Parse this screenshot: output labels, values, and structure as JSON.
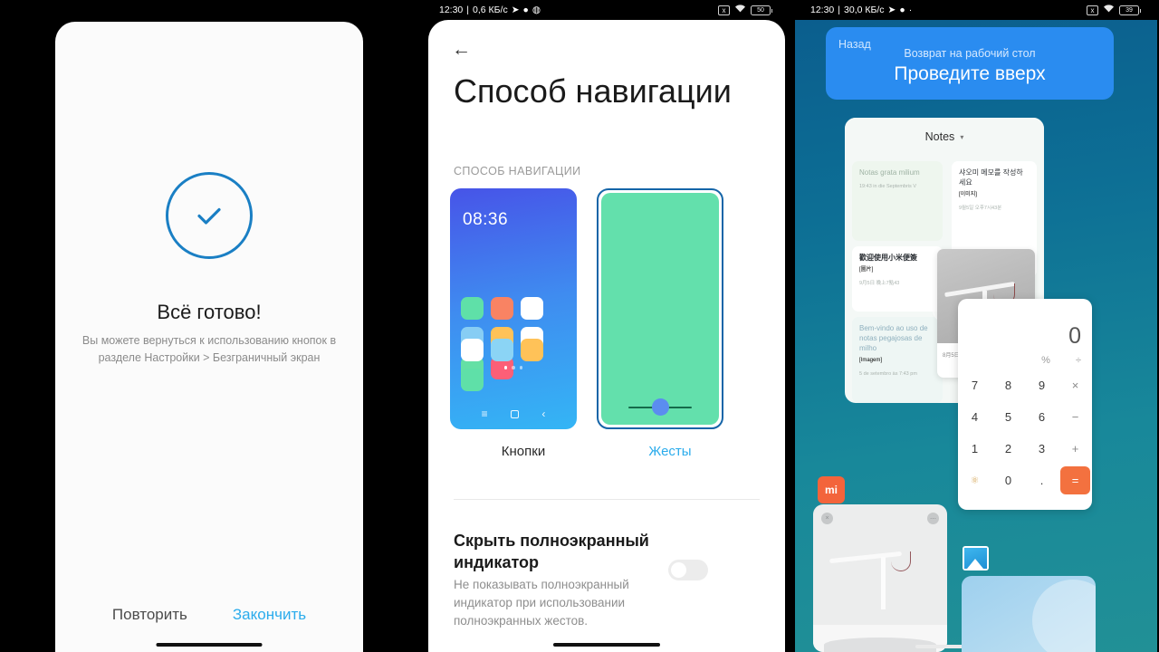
{
  "panel1": {
    "icon": "check-circle-icon",
    "accent_color": "#1a7fc4",
    "title": "Всё готово!",
    "description": "Вы можете вернуться к использованию кнопок в разделе Настройки > Безграничный экран",
    "repeat_label": "Повторить",
    "finish_label": "Закончить"
  },
  "panel2": {
    "status_bar": {
      "time": "12:30",
      "separator": "|",
      "net_speed": "0,6 КБ/с",
      "icons": [
        "telegram-icon",
        "message-icon",
        "flame-icon"
      ],
      "right_icons": [
        "no-sim-icon",
        "wifi-icon"
      ],
      "battery": "50"
    },
    "back_icon": "arrow-left-icon",
    "title": "Способ навигации",
    "section_header": "СПОСОБ НАВИГАЦИИ",
    "preview_buttons": {
      "clock": "08:36",
      "nav_icons": [
        "menu-icon",
        "home-icon",
        "back-icon"
      ],
      "label": "Кнопки",
      "selected": false,
      "app_colors": [
        "#5fe0a8",
        "#f98363",
        "#ffffff",
        "#87cdf4",
        "#ffc258",
        "#ffffff",
        "#64e0a5",
        "#fc5f77",
        "#ffffff",
        "#8bd4f5",
        "#ffc258",
        "#5fe0a8"
      ]
    },
    "preview_gestures": {
      "label": "Жесты",
      "selected": true,
      "screen_color": "#63e0ac",
      "indicator_color": "#5b8def"
    },
    "setting": {
      "title": "Скрыть полноэкранный индикатор",
      "description": "Не показывать полноэкранный индикатор при использовании полноэкранных жестов.",
      "toggle_on": false
    }
  },
  "panel3": {
    "status_bar": {
      "time": "12:30",
      "separator": "|",
      "net_speed": "30,0 КБ/с",
      "icons": [
        "telegram-icon",
        "message-icon",
        "dot-icon"
      ],
      "right_icons": [
        "no-sim-icon",
        "wifi-icon"
      ],
      "battery": "39"
    },
    "banner": {
      "back_label": "Назад",
      "subtitle": "Возврат на рабочий стол",
      "main": "Проведите вверх",
      "color": "#2a8cf0"
    },
    "notes_card": {
      "title": "Notes",
      "caret_icon": "chevron-down-icon",
      "notes": [
        {
          "title": "Notas grata milium",
          "meta": "",
          "date": "19:43 in die Septembris V"
        },
        {
          "title": "샤오미 메모를 작성하세요",
          "meta": "[이미지]",
          "date": "9월5일  오후7시43분"
        },
        {
          "title": "歡迎使用小米便簽",
          "meta": "[圖片]",
          "date": "9月5日 晚上7點43"
        },
        {
          "title": "Bem-vindo ao uso de notas pegajosas de milho",
          "meta": "[Imagem]",
          "date": "5 de setembro às 7:43 pm"
        }
      ]
    },
    "photo_card": {
      "image": "desk-lamp-photo",
      "caption": "8月5日 晚上7:7:43"
    },
    "calculator": {
      "display": "0",
      "secondary_ops": [
        "%",
        "÷"
      ],
      "keys": [
        [
          "7",
          "8",
          "9",
          "×"
        ],
        [
          "4",
          "5",
          "6",
          "−"
        ],
        [
          "1",
          "2",
          "3",
          "+"
        ],
        [
          "fn",
          "0",
          ".",
          "="
        ]
      ],
      "equals_color": "#f3713f"
    },
    "mi_logo": "mi-logo-icon",
    "lamp_card": "desk-lamp-card",
    "gallery_icon": "gallery-icon",
    "blue_card": "wallpaper-card"
  }
}
